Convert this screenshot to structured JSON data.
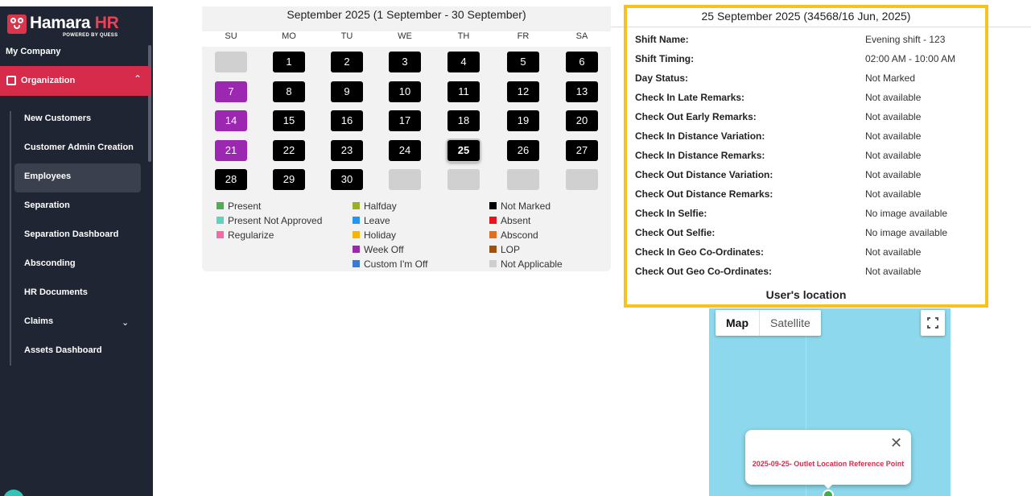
{
  "sidebar": {
    "logo_text_main": "Hamara",
    "logo_text_accent": "HR",
    "logo_sub": "POWERED BY QUESS",
    "my_company": "My Company",
    "section": "Organization",
    "items": [
      {
        "label": "New Customers"
      },
      {
        "label": "Customer Admin Creation"
      },
      {
        "label": "Employees"
      },
      {
        "label": "Separation"
      },
      {
        "label": "Separation Dashboard"
      },
      {
        "label": "Absconding"
      },
      {
        "label": "HR Documents"
      },
      {
        "label": "Claims"
      },
      {
        "label": "Assets Dashboard"
      }
    ],
    "active_item": "Employees",
    "accent_color": "#d62b4a"
  },
  "calendar": {
    "title": "September 2025 (1 September - 30 September)",
    "weekdays": [
      "SU",
      "MO",
      "TU",
      "WE",
      "TH",
      "FR",
      "SA"
    ],
    "weeks": [
      [
        {
          "d": "",
          "s": "na"
        },
        {
          "d": "1",
          "s": "nm"
        },
        {
          "d": "2",
          "s": "nm"
        },
        {
          "d": "3",
          "s": "nm"
        },
        {
          "d": "4",
          "s": "nm"
        },
        {
          "d": "5",
          "s": "nm"
        },
        {
          "d": "6",
          "s": "nm"
        }
      ],
      [
        {
          "d": "7",
          "s": "wo"
        },
        {
          "d": "8",
          "s": "nm"
        },
        {
          "d": "9",
          "s": "nm"
        },
        {
          "d": "10",
          "s": "nm"
        },
        {
          "d": "11",
          "s": "nm"
        },
        {
          "d": "12",
          "s": "nm"
        },
        {
          "d": "13",
          "s": "nm"
        }
      ],
      [
        {
          "d": "14",
          "s": "wo"
        },
        {
          "d": "15",
          "s": "nm"
        },
        {
          "d": "16",
          "s": "nm"
        },
        {
          "d": "17",
          "s": "nm"
        },
        {
          "d": "18",
          "s": "nm"
        },
        {
          "d": "19",
          "s": "nm"
        },
        {
          "d": "20",
          "s": "nm"
        }
      ],
      [
        {
          "d": "21",
          "s": "wo"
        },
        {
          "d": "22",
          "s": "nm"
        },
        {
          "d": "23",
          "s": "nm"
        },
        {
          "d": "24",
          "s": "nm"
        },
        {
          "d": "25",
          "s": "nm",
          "selected": true
        },
        {
          "d": "26",
          "s": "nm"
        },
        {
          "d": "27",
          "s": "nm"
        }
      ],
      [
        {
          "d": "28",
          "s": "nm"
        },
        {
          "d": "29",
          "s": "nm"
        },
        {
          "d": "30",
          "s": "nm"
        },
        {
          "d": "",
          "s": "na"
        },
        {
          "d": "",
          "s": "na"
        },
        {
          "d": "",
          "s": "na"
        },
        {
          "d": "",
          "s": "na"
        }
      ]
    ],
    "legend": [
      [
        {
          "label": "Present",
          "color": "#4caf50"
        },
        {
          "label": "Present Not Approved",
          "color": "#5fd3c0"
        },
        {
          "label": "Regularize",
          "color": "#f06ba8"
        }
      ],
      [
        {
          "label": "Halfday",
          "color": "#9cb027"
        },
        {
          "label": "Leave",
          "color": "#2196f3"
        },
        {
          "label": "Holiday",
          "color": "#f7b500"
        },
        {
          "label": "Week Off",
          "color": "#9c27b0"
        },
        {
          "label": "Custom I'm Off",
          "color": "#3a7bd5"
        }
      ],
      [
        {
          "label": "Not Marked",
          "color": "#000000"
        },
        {
          "label": "Absent",
          "color": "#e8141c"
        },
        {
          "label": "Abscond",
          "color": "#e07020"
        },
        {
          "label": "LOP",
          "color": "#a0520a"
        },
        {
          "label": "Not Applicable",
          "color": "#cfcfcf"
        }
      ]
    ]
  },
  "details": {
    "title": "25 September 2025 (34568/16 Jun, 2025)",
    "rows": [
      {
        "label": "Shift Name:",
        "value": "Evening shift - 123"
      },
      {
        "label": "Shift Timing:",
        "value": "02:00 AM - 10:00 AM"
      },
      {
        "label": "Day Status:",
        "value": "Not Marked"
      },
      {
        "label": "Check In Late Remarks:",
        "value": "Not available"
      },
      {
        "label": "Check Out Early Remarks:",
        "value": "Not available"
      },
      {
        "label": "Check In Distance Variation:",
        "value": "Not available"
      },
      {
        "label": "Check In Distance Remarks:",
        "value": "Not available"
      },
      {
        "label": "Check Out Distance Variation:",
        "value": "Not available"
      },
      {
        "label": "Check Out Distance Remarks:",
        "value": "Not available"
      },
      {
        "label": "Check In Selfie:",
        "value": "No image available"
      },
      {
        "label": "Check Out Selfie:",
        "value": "No image available"
      },
      {
        "label": "Check In Geo Co-Ordinates:",
        "value": "Not available"
      },
      {
        "label": "Check Out Geo Co-Ordinates:",
        "value": "Not available"
      }
    ],
    "location_title": "User's location",
    "highlight_color": "#f7c21c"
  },
  "map": {
    "map_label": "Map",
    "satellite_label": "Satellite",
    "active_view": "Map",
    "popup_text": "2025-09-25- Outlet Location Reference Point",
    "popup_close": "✕"
  }
}
